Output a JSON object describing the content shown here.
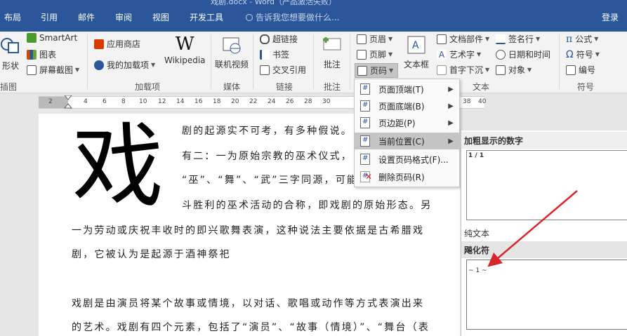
{
  "window": {
    "title": "戏剧.docx - Word（产品激活失败）"
  },
  "tabs": [
    "布局",
    "引用",
    "邮件",
    "审阅",
    "视图",
    "开发工具"
  ],
  "tell_me": "告诉我您想要做什么...",
  "login": "登录",
  "ribbon": {
    "shape": "形状",
    "smartart": "SmartArt",
    "chart": "图表",
    "screenshot": "屏幕截图",
    "illustrations_label": "插图",
    "store": "应用商店",
    "my_addins": "我的加载项",
    "wikipedia": "Wikipedia",
    "addins_label": "加载项",
    "online_video": "联机视频",
    "media_label": "媒体",
    "hyperlink": "超链接",
    "bookmark": "书签",
    "cross_ref": "交叉引用",
    "links_label": "链接",
    "comment": "批注",
    "comment_label": "批注",
    "header": "页眉",
    "footer": "页脚",
    "page_number": "页码",
    "textbox": "文本框",
    "doc_parts": "文档部件",
    "wordart": "艺术字",
    "dropcap": "首字下沉",
    "signature": "签名行",
    "datetime": "日期和时间",
    "object": "对象",
    "text_label": "文本",
    "equation": "公式",
    "symbol": "符号",
    "numbering": "编号",
    "symbols_label": "符号"
  },
  "ruler": [
    "2",
    "2",
    "4",
    "6",
    "8",
    "10",
    "12",
    "14",
    "16",
    "18",
    "20",
    "22",
    "24",
    "26",
    "28",
    "30",
    "32",
    "34",
    "36",
    "38"
  ],
  "document": {
    "dropcap": "戏",
    "lines": [
      "剧的起源实不可考，有多种假说。",
      "有二：一为原始宗教的巫术仪式，",
      "“巫”、“舞”、“武”三字同源，可能",
      "斗胜利的巫术活动的合称，即戏剧的原始形态。另",
      "一为劳动或庆祝丰收时的即兴歌舞表演，这种说法主要依据是古希腊戏",
      "剧，它被认为是起源于酒神祭祀",
      "戏剧是由演员将某个故事或情境，以对话、歌唱或动作等方式表演出来",
      "的艺术。戏剧有四个元素，包括了“演员”、“故事（情境）”、“舞台（表"
    ]
  },
  "menu": {
    "items": [
      {
        "label": "页面顶端(T)",
        "state": "normal"
      },
      {
        "label": "页面底端(B)",
        "state": "normal"
      },
      {
        "label": "页边距(P)",
        "state": "normal"
      },
      {
        "label": "当前位置(C)",
        "state": "highlighted"
      },
      {
        "label": "设置页码格式(F)...",
        "state": "normal"
      },
      {
        "label": "删除页码(R)",
        "state": "normal"
      }
    ]
  },
  "gallery": {
    "header_bold": "加粗显示的数字",
    "preview1": "1 / 1",
    "plain_text": "纯文本",
    "tilde_header": "飚化符",
    "preview2": "~ 1 ~"
  },
  "colors": {
    "accent": "#2b579a",
    "arrow": "#d9262c",
    "highlight": "#c5c5c5"
  }
}
